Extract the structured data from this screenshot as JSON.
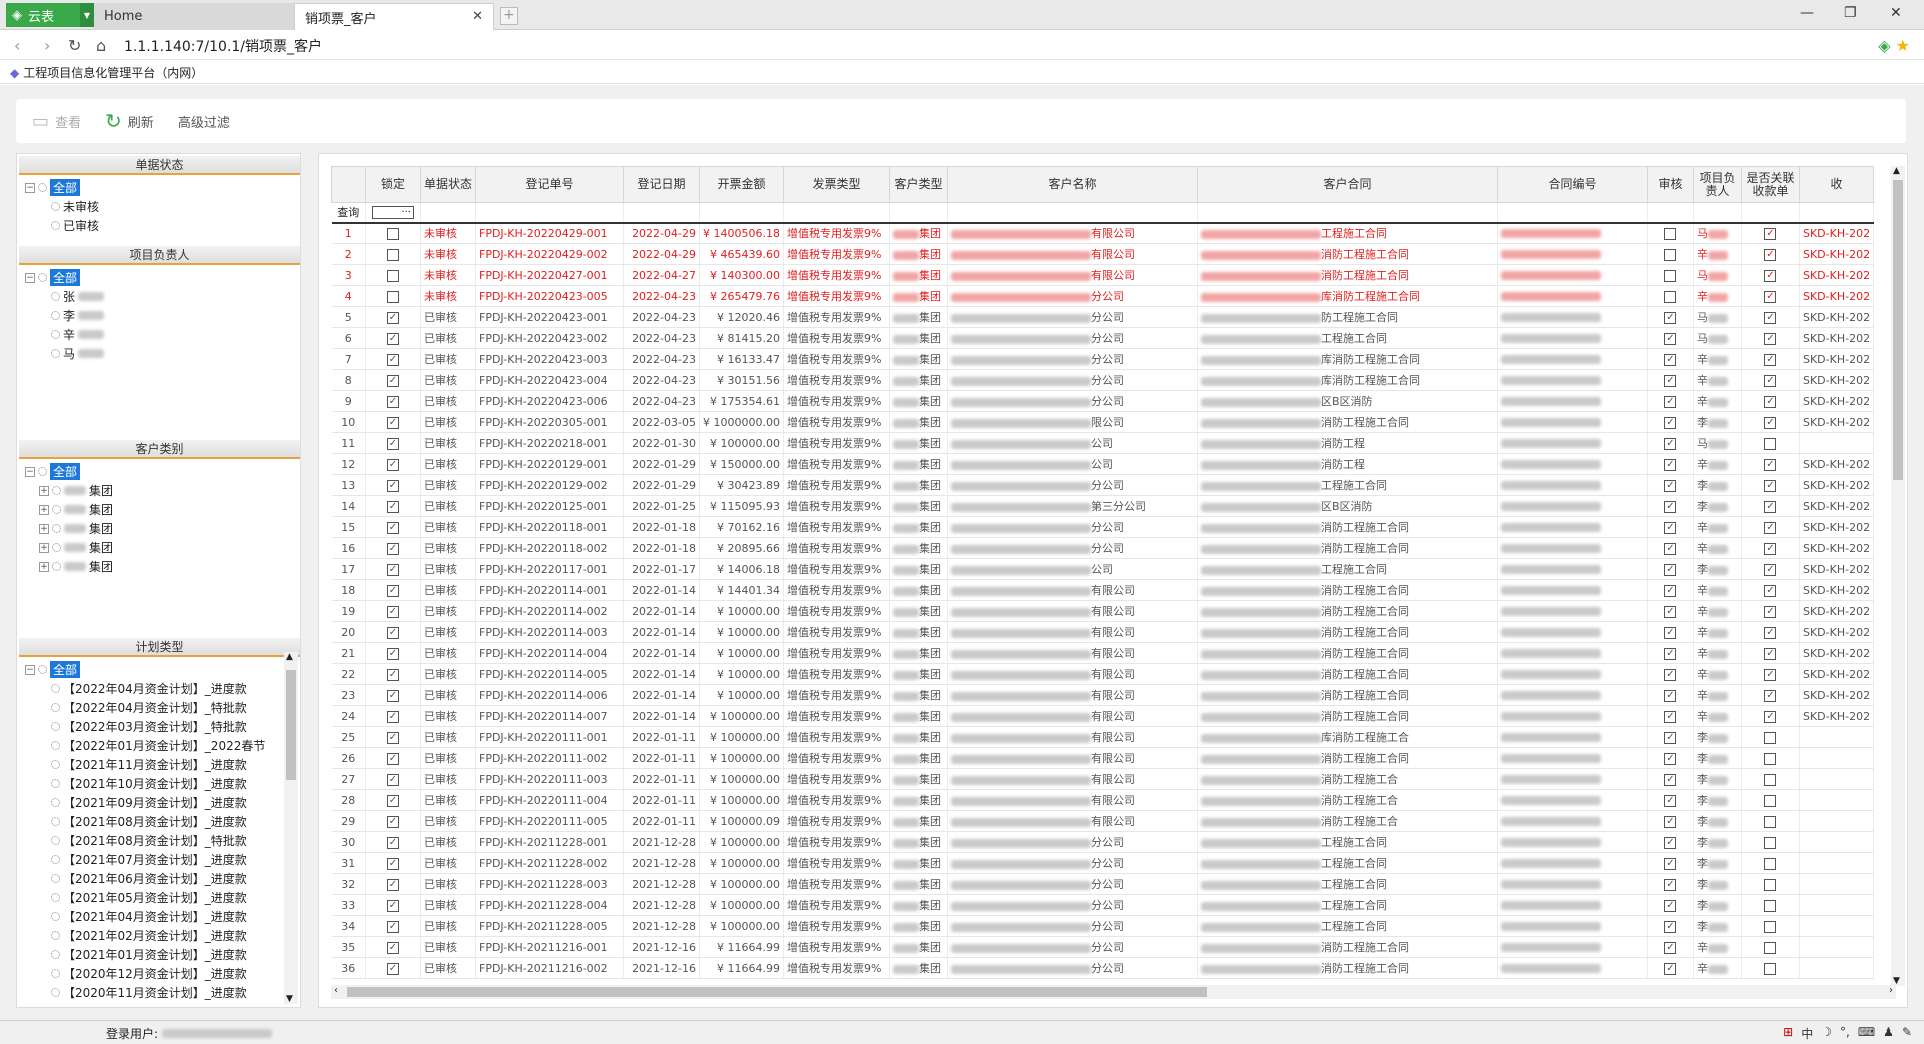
{
  "app": {
    "name": "云表"
  },
  "tabs": [
    {
      "label": "Home"
    },
    {
      "label": "销项票_客户"
    }
  ],
  "address": {
    "url": "1.1.1.140:7/10.1/销项票_客户"
  },
  "bookmark": {
    "label": "工程项目信息化管理平台（内网）"
  },
  "toolbar": {
    "view": "查看",
    "refresh": "刷新",
    "advanced_filter": "高级过滤"
  },
  "left": {
    "doc_status": {
      "title": "单据状态",
      "root": "全部",
      "items": [
        "未审核",
        "已审核"
      ]
    },
    "owner": {
      "title": "项目负责人",
      "root": "全部",
      "items": [
        "张",
        "李",
        "辛",
        "马"
      ]
    },
    "customer_type": {
      "title": "客户类别",
      "root": "全部",
      "items": [
        "集团",
        "集团",
        "集团",
        "集团",
        "集团"
      ]
    },
    "plan_type": {
      "title": "计划类型",
      "root": "全部",
      "items": [
        "【2022年04月资金计划】_进度款",
        "【2022年04月资金计划】_特批款",
        "【2022年03月资金计划】_特批款",
        "【2022年01月资金计划】_2022春节",
        "【2021年11月资金计划】_进度款",
        "【2021年10月资金计划】_进度款",
        "【2021年09月资金计划】_进度款",
        "【2021年08月资金计划】_进度款",
        "【2021年08月资金计划】_特批款",
        "【2021年07月资金计划】_进度款",
        "【2021年06月资金计划】_进度款",
        "【2021年05月资金计划】_进度款",
        "【2021年04月资金计划】_进度款",
        "【2021年02月资金计划】_进度款",
        "【2021年01月资金计划】_进度款",
        "【2020年12月资金计划】_进度款",
        "【2020年11月资金计划】_进度款"
      ]
    }
  },
  "grid": {
    "columns": [
      "锁定",
      "单据状态",
      "登记单号",
      "登记日期",
      "开票金额",
      "发票类型",
      "客户类型",
      "客户名称",
      "客户合同",
      "合同编号",
      "审核",
      "项目负责人",
      "是否关联收款单",
      "收"
    ],
    "query_label": "查询",
    "query_btn": "···",
    "rows": [
      {
        "n": "1",
        "locked": false,
        "status": "未审核",
        "no": "FPDJ-KH-20220429-001",
        "date": "2022-04-29",
        "amount": "¥ 1400506.18",
        "type": "增值税专用发票9%",
        "ctype": "集团",
        "cname": "有限公司",
        "contract": "工程施工合同",
        "cno": "",
        "review": false,
        "owner": "马",
        "linked": true,
        "rec": "SKD-KH-202"
      },
      {
        "n": "2",
        "locked": false,
        "status": "未审核",
        "no": "FPDJ-KH-20220429-002",
        "date": "2022-04-29",
        "amount": "¥ 465439.60",
        "type": "增值税专用发票9%",
        "ctype": "集团",
        "cname": "有限公司",
        "contract": "消防工程施工合同",
        "cno": "",
        "review": false,
        "owner": "辛",
        "linked": true,
        "rec": "SKD-KH-202"
      },
      {
        "n": "3",
        "locked": false,
        "status": "未审核",
        "no": "FPDJ-KH-20220427-001",
        "date": "2022-04-27",
        "amount": "¥ 140300.00",
        "type": "增值税专用发票9%",
        "ctype": "集团",
        "cname": "有限公司",
        "contract": "消防工程施工合同",
        "cno": "",
        "review": false,
        "owner": "马",
        "linked": true,
        "rec": "SKD-KH-202"
      },
      {
        "n": "4",
        "locked": false,
        "status": "未审核",
        "no": "FPDJ-KH-20220423-005",
        "date": "2022-04-23",
        "amount": "¥ 265479.76",
        "type": "增值税专用发票9%",
        "ctype": "集团",
        "cname": "分公司",
        "contract": "库消防工程施工合同",
        "cno": "",
        "review": false,
        "owner": "辛",
        "linked": true,
        "rec": "SKD-KH-202"
      },
      {
        "n": "5",
        "locked": true,
        "status": "已审核",
        "no": "FPDJ-KH-20220423-001",
        "date": "2022-04-23",
        "amount": "¥ 12020.46",
        "type": "增值税专用发票9%",
        "ctype": "集团",
        "cname": "分公司",
        "contract": "防工程施工合同",
        "cno": "",
        "review": true,
        "owner": "马",
        "linked": true,
        "rec": "SKD-KH-202"
      },
      {
        "n": "6",
        "locked": true,
        "status": "已审核",
        "no": "FPDJ-KH-20220423-002",
        "date": "2022-04-23",
        "amount": "¥ 81415.20",
        "type": "增值税专用发票9%",
        "ctype": "集团",
        "cname": "分公司",
        "contract": "工程施工合同",
        "cno": "",
        "review": true,
        "owner": "马",
        "linked": true,
        "rec": "SKD-KH-202"
      },
      {
        "n": "7",
        "locked": true,
        "status": "已审核",
        "no": "FPDJ-KH-20220423-003",
        "date": "2022-04-23",
        "amount": "¥ 16133.47",
        "type": "增值税专用发票9%",
        "ctype": "集团",
        "cname": "分公司",
        "contract": "库消防工程施工合同",
        "cno": "",
        "review": true,
        "owner": "辛",
        "linked": true,
        "rec": "SKD-KH-202"
      },
      {
        "n": "8",
        "locked": true,
        "status": "已审核",
        "no": "FPDJ-KH-20220423-004",
        "date": "2022-04-23",
        "amount": "¥ 30151.56",
        "type": "增值税专用发票9%",
        "ctype": "集团",
        "cname": "分公司",
        "contract": "库消防工程施工合同",
        "cno": "",
        "review": true,
        "owner": "辛",
        "linked": true,
        "rec": "SKD-KH-202"
      },
      {
        "n": "9",
        "locked": true,
        "status": "已审核",
        "no": "FPDJ-KH-20220423-006",
        "date": "2022-04-23",
        "amount": "¥ 175354.61",
        "type": "增值税专用发票9%",
        "ctype": "集团",
        "cname": "分公司",
        "contract": "区B区消防",
        "cno": "",
        "review": true,
        "owner": "辛",
        "linked": true,
        "rec": "SKD-KH-202"
      },
      {
        "n": "10",
        "locked": true,
        "status": "已审核",
        "no": "FPDJ-KH-20220305-001",
        "date": "2022-03-05",
        "amount": "¥ 1000000.00",
        "type": "增值税专用发票9%",
        "ctype": "集团",
        "cname": "限公司",
        "contract": "消防工程施工合同",
        "cno": "",
        "review": true,
        "owner": "李",
        "linked": true,
        "rec": "SKD-KH-202"
      },
      {
        "n": "11",
        "locked": true,
        "status": "已审核",
        "no": "FPDJ-KH-20220218-001",
        "date": "2022-01-30",
        "amount": "¥ 100000.00",
        "type": "增值税专用发票9%",
        "ctype": "集团",
        "cname": "公司",
        "contract": "消防工程",
        "cno": "",
        "review": true,
        "owner": "马",
        "linked": false,
        "rec": ""
      },
      {
        "n": "12",
        "locked": true,
        "status": "已审核",
        "no": "FPDJ-KH-20220129-001",
        "date": "2022-01-29",
        "amount": "¥ 150000.00",
        "type": "增值税专用发票9%",
        "ctype": "集团",
        "cname": "公司",
        "contract": "消防工程",
        "cno": "",
        "review": true,
        "owner": "辛",
        "linked": true,
        "rec": "SKD-KH-202"
      },
      {
        "n": "13",
        "locked": true,
        "status": "已审核",
        "no": "FPDJ-KH-20220129-002",
        "date": "2022-01-29",
        "amount": "¥ 30423.89",
        "type": "增值税专用发票9%",
        "ctype": "集团",
        "cname": "分公司",
        "contract": "工程施工合同",
        "cno": "",
        "review": true,
        "owner": "李",
        "linked": true,
        "rec": "SKD-KH-202"
      },
      {
        "n": "14",
        "locked": true,
        "status": "已审核",
        "no": "FPDJ-KH-20220125-001",
        "date": "2022-01-25",
        "amount": "¥ 115095.93",
        "type": "增值税专用发票9%",
        "ctype": "集团",
        "cname": "第三分公司",
        "contract": "区B区消防",
        "cno": "",
        "review": true,
        "owner": "李",
        "linked": true,
        "rec": "SKD-KH-202"
      },
      {
        "n": "15",
        "locked": true,
        "status": "已审核",
        "no": "FPDJ-KH-20220118-001",
        "date": "2022-01-18",
        "amount": "¥ 70162.16",
        "type": "增值税专用发票9%",
        "ctype": "集团",
        "cname": "分公司",
        "contract": "消防工程施工合同",
        "cno": "",
        "review": true,
        "owner": "辛",
        "linked": true,
        "rec": "SKD-KH-202"
      },
      {
        "n": "16",
        "locked": true,
        "status": "已审核",
        "no": "FPDJ-KH-20220118-002",
        "date": "2022-01-18",
        "amount": "¥ 20895.66",
        "type": "增值税专用发票9%",
        "ctype": "集团",
        "cname": "分公司",
        "contract": "消防工程施工合同",
        "cno": "",
        "review": true,
        "owner": "辛",
        "linked": true,
        "rec": "SKD-KH-202"
      },
      {
        "n": "17",
        "locked": true,
        "status": "已审核",
        "no": "FPDJ-KH-20220117-001",
        "date": "2022-01-17",
        "amount": "¥ 14006.18",
        "type": "增值税专用发票9%",
        "ctype": "集团",
        "cname": "公司",
        "contract": "工程施工合同",
        "cno": "",
        "review": true,
        "owner": "李",
        "linked": true,
        "rec": "SKD-KH-202"
      },
      {
        "n": "18",
        "locked": true,
        "status": "已审核",
        "no": "FPDJ-KH-20220114-001",
        "date": "2022-01-14",
        "amount": "¥ 14401.34",
        "type": "增值税专用发票9%",
        "ctype": "集团",
        "cname": "有限公司",
        "contract": "消防工程施工合同",
        "cno": "",
        "review": true,
        "owner": "辛",
        "linked": true,
        "rec": "SKD-KH-202"
      },
      {
        "n": "19",
        "locked": true,
        "status": "已审核",
        "no": "FPDJ-KH-20220114-002",
        "date": "2022-01-14",
        "amount": "¥ 10000.00",
        "type": "增值税专用发票9%",
        "ctype": "集团",
        "cname": "有限公司",
        "contract": "消防工程施工合同",
        "cno": "",
        "review": true,
        "owner": "辛",
        "linked": true,
        "rec": "SKD-KH-202"
      },
      {
        "n": "20",
        "locked": true,
        "status": "已审核",
        "no": "FPDJ-KH-20220114-003",
        "date": "2022-01-14",
        "amount": "¥ 10000.00",
        "type": "增值税专用发票9%",
        "ctype": "集团",
        "cname": "有限公司",
        "contract": "消防工程施工合同",
        "cno": "",
        "review": true,
        "owner": "辛",
        "linked": true,
        "rec": "SKD-KH-202"
      },
      {
        "n": "21",
        "locked": true,
        "status": "已审核",
        "no": "FPDJ-KH-20220114-004",
        "date": "2022-01-14",
        "amount": "¥ 10000.00",
        "type": "增值税专用发票9%",
        "ctype": "集团",
        "cname": "有限公司",
        "contract": "消防工程施工合同",
        "cno": "",
        "review": true,
        "owner": "辛",
        "linked": true,
        "rec": "SKD-KH-202"
      },
      {
        "n": "22",
        "locked": true,
        "status": "已审核",
        "no": "FPDJ-KH-20220114-005",
        "date": "2022-01-14",
        "amount": "¥ 10000.00",
        "type": "增值税专用发票9%",
        "ctype": "集团",
        "cname": "有限公司",
        "contract": "消防工程施工合同",
        "cno": "",
        "review": true,
        "owner": "辛",
        "linked": true,
        "rec": "SKD-KH-202"
      },
      {
        "n": "23",
        "locked": true,
        "status": "已审核",
        "no": "FPDJ-KH-20220114-006",
        "date": "2022-01-14",
        "amount": "¥ 10000.00",
        "type": "增值税专用发票9%",
        "ctype": "集团",
        "cname": "有限公司",
        "contract": "消防工程施工合同",
        "cno": "",
        "review": true,
        "owner": "辛",
        "linked": true,
        "rec": "SKD-KH-202"
      },
      {
        "n": "24",
        "locked": true,
        "status": "已审核",
        "no": "FPDJ-KH-20220114-007",
        "date": "2022-01-14",
        "amount": "¥ 100000.00",
        "type": "增值税专用发票9%",
        "ctype": "集团",
        "cname": "有限公司",
        "contract": "消防工程施工合同",
        "cno": "",
        "review": true,
        "owner": "辛",
        "linked": true,
        "rec": "SKD-KH-202"
      },
      {
        "n": "25",
        "locked": true,
        "status": "已审核",
        "no": "FPDJ-KH-20220111-001",
        "date": "2022-01-11",
        "amount": "¥ 100000.00",
        "type": "增值税专用发票9%",
        "ctype": "集团",
        "cname": "有限公司",
        "contract": "库消防工程施工合",
        "cno": "",
        "review": true,
        "owner": "李",
        "linked": false,
        "rec": ""
      },
      {
        "n": "26",
        "locked": true,
        "status": "已审核",
        "no": "FPDJ-KH-20220111-002",
        "date": "2022-01-11",
        "amount": "¥ 100000.00",
        "type": "增值税专用发票9%",
        "ctype": "集团",
        "cname": "有限公司",
        "contract": "消防工程施工合同",
        "cno": "",
        "review": true,
        "owner": "李",
        "linked": false,
        "rec": ""
      },
      {
        "n": "27",
        "locked": true,
        "status": "已审核",
        "no": "FPDJ-KH-20220111-003",
        "date": "2022-01-11",
        "amount": "¥ 100000.00",
        "type": "增值税专用发票9%",
        "ctype": "集团",
        "cname": "有限公司",
        "contract": "消防工程施工合",
        "cno": "",
        "review": true,
        "owner": "李",
        "linked": false,
        "rec": ""
      },
      {
        "n": "28",
        "locked": true,
        "status": "已审核",
        "no": "FPDJ-KH-20220111-004",
        "date": "2022-01-11",
        "amount": "¥ 100000.00",
        "type": "增值税专用发票9%",
        "ctype": "集团",
        "cname": "有限公司",
        "contract": "消防工程施工合",
        "cno": "",
        "review": true,
        "owner": "李",
        "linked": false,
        "rec": ""
      },
      {
        "n": "29",
        "locked": true,
        "status": "已审核",
        "no": "FPDJ-KH-20220111-005",
        "date": "2022-01-11",
        "amount": "¥ 100000.09",
        "type": "增值税专用发票9%",
        "ctype": "集团",
        "cname": "有限公司",
        "contract": "消防工程施工合",
        "cno": "",
        "review": true,
        "owner": "李",
        "linked": false,
        "rec": ""
      },
      {
        "n": "30",
        "locked": true,
        "status": "已审核",
        "no": "FPDJ-KH-20211228-001",
        "date": "2021-12-28",
        "amount": "¥ 100000.00",
        "type": "增值税专用发票9%",
        "ctype": "集团",
        "cname": "分公司",
        "contract": "工程施工合同",
        "cno": "",
        "review": true,
        "owner": "李",
        "linked": false,
        "rec": ""
      },
      {
        "n": "31",
        "locked": true,
        "status": "已审核",
        "no": "FPDJ-KH-20211228-002",
        "date": "2021-12-28",
        "amount": "¥ 100000.00",
        "type": "增值税专用发票9%",
        "ctype": "集团",
        "cname": "分公司",
        "contract": "工程施工合同",
        "cno": "",
        "review": true,
        "owner": "李",
        "linked": false,
        "rec": ""
      },
      {
        "n": "32",
        "locked": true,
        "status": "已审核",
        "no": "FPDJ-KH-20211228-003",
        "date": "2021-12-28",
        "amount": "¥ 100000.00",
        "type": "增值税专用发票9%",
        "ctype": "集团",
        "cname": "分公司",
        "contract": "工程施工合同",
        "cno": "",
        "review": true,
        "owner": "李",
        "linked": false,
        "rec": ""
      },
      {
        "n": "33",
        "locked": true,
        "status": "已审核",
        "no": "FPDJ-KH-20211228-004",
        "date": "2021-12-28",
        "amount": "¥ 100000.00",
        "type": "增值税专用发票9%",
        "ctype": "集团",
        "cname": "分公司",
        "contract": "工程施工合同",
        "cno": "",
        "review": true,
        "owner": "李",
        "linked": false,
        "rec": ""
      },
      {
        "n": "34",
        "locked": true,
        "status": "已审核",
        "no": "FPDJ-KH-20211228-005",
        "date": "2021-12-28",
        "amount": "¥ 100000.00",
        "type": "增值税专用发票9%",
        "ctype": "集团",
        "cname": "分公司",
        "contract": "工程施工合同",
        "cno": "",
        "review": true,
        "owner": "李",
        "linked": false,
        "rec": ""
      },
      {
        "n": "35",
        "locked": true,
        "status": "已审核",
        "no": "FPDJ-KH-20211216-001",
        "date": "2021-12-16",
        "amount": "¥ 11664.99",
        "type": "增值税专用发票9%",
        "ctype": "集团",
        "cname": "分公司",
        "contract": "消防工程施工合同",
        "cno": "",
        "review": true,
        "owner": "辛",
        "linked": false,
        "rec": ""
      },
      {
        "n": "36",
        "locked": true,
        "status": "已审核",
        "no": "FPDJ-KH-20211216-002",
        "date": "2021-12-16",
        "amount": "¥ 11664.99",
        "type": "增值税专用发票9%",
        "ctype": "集团",
        "cname": "分公司",
        "contract": "消防工程施工合同",
        "cno": "",
        "review": true,
        "owner": "辛",
        "linked": false,
        "rec": ""
      }
    ]
  },
  "status": {
    "login_label": "登录用户:"
  },
  "tray": [
    "中",
    "☽",
    "°,",
    "⌨",
    "♟",
    "✎"
  ]
}
